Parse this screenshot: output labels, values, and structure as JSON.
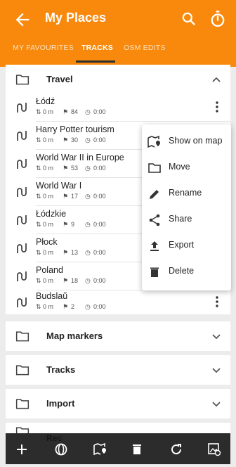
{
  "appbar": {
    "title": "My Places"
  },
  "tabs": [
    {
      "label": "MY FAVOURITES"
    },
    {
      "label": "TRACKS"
    },
    {
      "label": "OSM EDITS"
    }
  ],
  "groups": {
    "travel": {
      "label": "Travel"
    },
    "map_markers": {
      "label": "Map markers"
    },
    "tracks": {
      "label": "Tracks"
    },
    "import": {
      "label": "Import"
    },
    "rec": {
      "label": "Rec"
    }
  },
  "tracks": [
    {
      "name": "Łódź",
      "distance": "0 m",
      "points": "84",
      "time": "0:00"
    },
    {
      "name": "Harry Potter tourism",
      "distance": "0 m",
      "points": "30",
      "time": "0:00"
    },
    {
      "name": "World War II in Europe",
      "distance": "0 m",
      "points": "53",
      "time": "0:00"
    },
    {
      "name": "World War I",
      "distance": "0 m",
      "points": "17",
      "time": "0:00"
    },
    {
      "name": "Łódzkie",
      "distance": "0 m",
      "points": "9",
      "time": "0:00"
    },
    {
      "name": "Płock",
      "distance": "0 m",
      "points": "13",
      "time": "0:00"
    },
    {
      "name": "Poland",
      "distance": "0 m",
      "points": "18",
      "time": "0:00"
    },
    {
      "name": "Budslaŭ",
      "distance": "0 m",
      "points": "2",
      "time": "0:00"
    }
  ],
  "menu": [
    {
      "label": "Show on map",
      "icon": "map-marker-icon"
    },
    {
      "label": "Move",
      "icon": "folder-icon"
    },
    {
      "label": "Rename",
      "icon": "pencil-icon"
    },
    {
      "label": "Share",
      "icon": "share-icon"
    },
    {
      "label": "Export",
      "icon": "upload-icon"
    },
    {
      "label": "Delete",
      "icon": "trash-icon"
    }
  ],
  "colors": {
    "accent": "#f8890d",
    "bottom_bar": "#2c2c2c"
  }
}
